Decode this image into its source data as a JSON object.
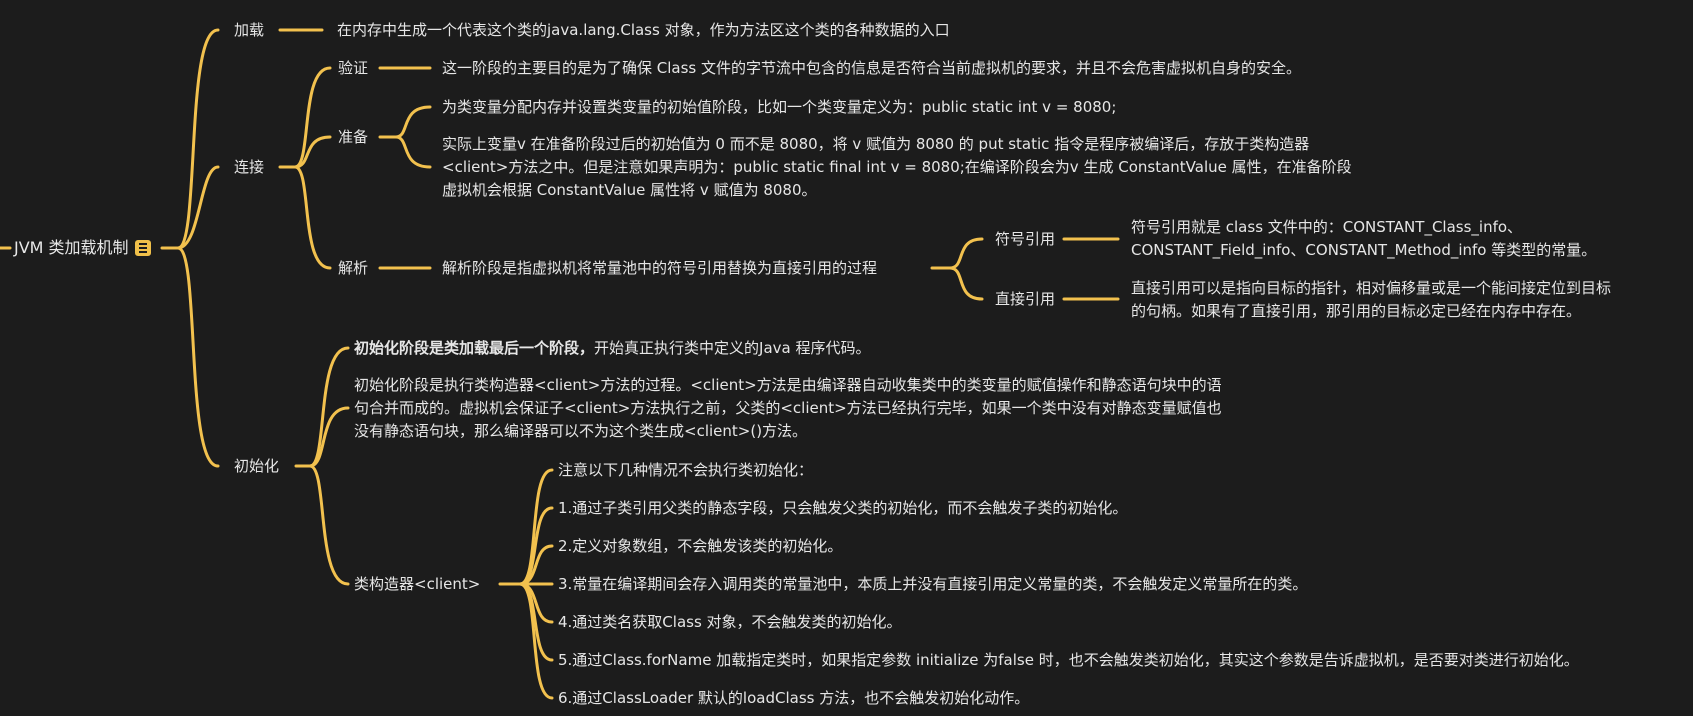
{
  "accent": "#f2c14e",
  "root": {
    "label": "JVM 类加载机制",
    "icon": "note-icon"
  },
  "load": {
    "label": "加载",
    "desc": "在内存中生成一个代表这个类的java.lang.Class 对象，作为方法区这个类的各种数据的入口"
  },
  "link": {
    "label": "连接",
    "verify": {
      "label": "验证",
      "desc": "这一阶段的主要目的是为了确保 Class 文件的字节流中包含的信息是否符合当前虚拟机的要求，并且不会危害虚拟机自身的安全。"
    },
    "prepare": {
      "label": "准备",
      "desc1": "为类变量分配内存并设置类变量的初始值阶段，比如一个类变量定义为：public static int v = 8080;",
      "desc2_line1": "实际上变量v 在准备阶段过后的初始值为 0 而不是 8080，将 v 赋值为 8080 的 put static 指令是程序被编译后，存放于类构造器",
      "desc2_line2": "<client>方法之中。但是注意如果声明为：public static final int v = 8080;在编译阶段会为v 生成 ConstantValue 属性，在准备阶段",
      "desc2_line3": "虚拟机会根据 ConstantValue 属性将 v 赋值为 8080。"
    },
    "resolve": {
      "label": "解析",
      "desc": "解析阶段是指虚拟机将常量池中的符号引用替换为直接引用的过程",
      "symbolic": {
        "label": "符号引用",
        "desc_line1": "符号引用就是 class 文件中的：CONSTANT_Class_info、",
        "desc_line2": "CONSTANT_Field_info、CONSTANT_Method_info 等类型的常量。"
      },
      "direct": {
        "label": "直接引用",
        "desc_line1": "直接引用可以是指向目标的指针，相对偏移量或是一个能间接定位到目标",
        "desc_line2": "的句柄。如果有了直接引用，那引用的目标必定已经在内存中存在。"
      }
    }
  },
  "init": {
    "label": "初始化",
    "item1_bold": "初始化阶段是类加载最后一个阶段，",
    "item1_rest": "开始真正执行类中定义的Java 程序代码。",
    "item2_line1": "初始化阶段是执行类构造器<client>方法的过程。<client>方法是由编译器自动收集类中的类变量的赋值操作和静态语句块中的语",
    "item2_line2": "句合并而成的。虚拟机会保证子<client>方法执行之前，父类的<client>方法已经执行完毕，如果一个类中没有对静态变量赋值也",
    "item2_line3": "没有静态语句块，那么编译器可以不为这个类生成<client>()方法。",
    "clinit": {
      "label": "类构造器<client>",
      "notes": [
        "注意以下几种情况不会执行类初始化：",
        "1.通过子类引用父类的静态字段，只会触发父类的初始化，而不会触发子类的初始化。",
        "2.定义对象数组，不会触发该类的初始化。",
        "3.常量在编译期间会存入调用类的常量池中，本质上并没有直接引用定义常量的类，不会触发定义常量所在的类。",
        "4.通过类名获取Class 对象，不会触发类的初始化。",
        "5.通过Class.forName 加载指定类时，如果指定参数 initialize 为false 时，也不会触发类初始化，其实这个参数是告诉虚拟机，是否要对类进行初始化。",
        "6.通过ClassLoader 默认的loadClass 方法，也不会触发初始化动作。"
      ]
    }
  }
}
